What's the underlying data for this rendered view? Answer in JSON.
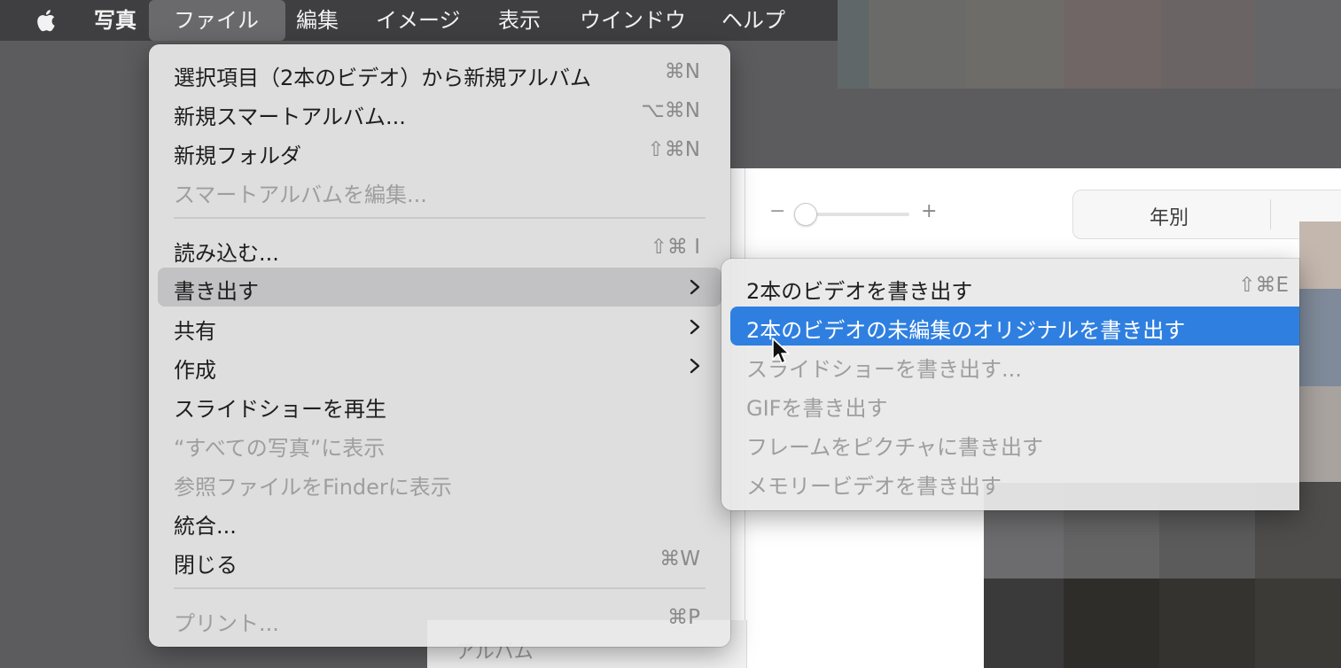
{
  "menubar": {
    "apple": "apple-icon",
    "items": [
      "写真",
      "ファイル",
      "編集",
      "イメージ",
      "表示",
      "ウインドウ",
      "ヘルプ"
    ]
  },
  "file_menu": {
    "items": [
      {
        "label": "選択項目（2本のビデオ）から新規アルバム",
        "shortcut": "⌘N"
      },
      {
        "label": "新規スマートアルバム...",
        "shortcut": "⌥⌘N"
      },
      {
        "label": "新規フォルダ",
        "shortcut": "⇧⌘N"
      },
      {
        "label": "スマートアルバムを編集...",
        "shortcut": ""
      },
      {
        "label": "読み込む...",
        "shortcut": "⇧⌘ I"
      },
      {
        "label": "書き出す",
        "shortcut": ""
      },
      {
        "label": "共有",
        "shortcut": ""
      },
      {
        "label": "作成",
        "shortcut": ""
      },
      {
        "label": "スライドショーを再生",
        "shortcut": ""
      },
      {
        "label": "“すべての写真”に表示",
        "shortcut": ""
      },
      {
        "label": "参照ファイルをFinderに表示",
        "shortcut": ""
      },
      {
        "label": "統合...",
        "shortcut": ""
      },
      {
        "label": "閉じる",
        "shortcut": "⌘W"
      },
      {
        "label": "プリント...",
        "shortcut": "⌘P"
      }
    ]
  },
  "export_menu": {
    "items": [
      {
        "label": "2本のビデオを書き出す",
        "shortcut": "⇧⌘E"
      },
      {
        "label": "2本のビデオの未編集のオリジナルを書き出す",
        "shortcut": ""
      },
      {
        "label": "スライドショーを書き出す...",
        "shortcut": ""
      },
      {
        "label": "GIFを書き出す",
        "shortcut": ""
      },
      {
        "label": "フレームをピクチャに書き出す",
        "shortcut": ""
      },
      {
        "label": "メモリービデオを書き出す",
        "shortcut": ""
      }
    ]
  },
  "toolbar": {
    "zoom_minus": "−",
    "zoom_plus": "+",
    "view_segment": "年別"
  },
  "sidebar": {
    "partial_label": "アルバム"
  },
  "colors": {
    "highlight_blue": "#2f7fe0",
    "menubar_bg": "#3f3f41"
  }
}
